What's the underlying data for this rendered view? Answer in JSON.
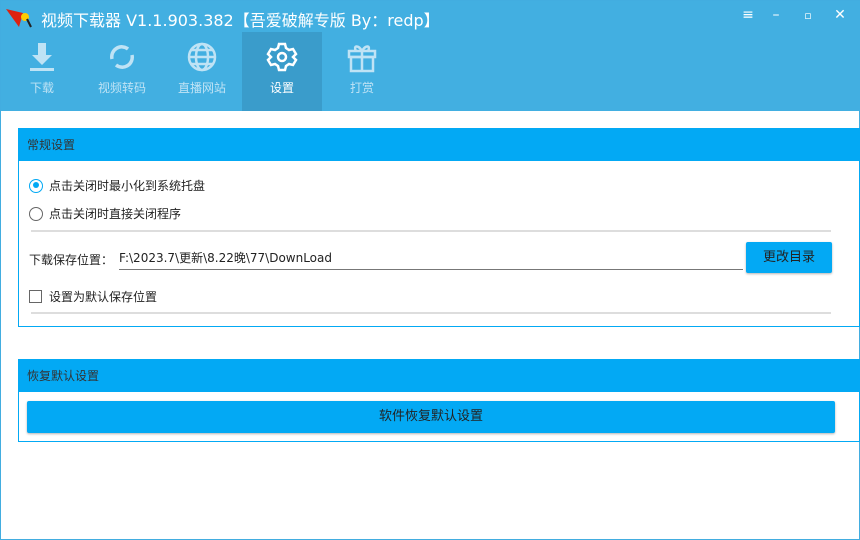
{
  "window": {
    "title": "视频下载器 V1.1.903.382【吾爱破解专版  By：redp】",
    "menu_icon": "menu-icon",
    "min_icon": "minimize-icon",
    "max_icon": "maximize-icon",
    "close_icon": "close-icon"
  },
  "tabs": [
    {
      "label": "下载",
      "icon": "download-icon"
    },
    {
      "label": "视频转码",
      "icon": "convert-icon"
    },
    {
      "label": "直播网站",
      "icon": "globe-icon"
    },
    {
      "label": "设置",
      "icon": "gear-icon",
      "active": true
    },
    {
      "label": "打赏",
      "icon": "gift-icon"
    }
  ],
  "general": {
    "title": "常规设置",
    "radio1": "点击关闭时最小化到系统托盘",
    "radio2": "点击关闭时直接关闭程序",
    "path_label": "下载保存位置：",
    "path_value": "F:\\2023.7\\更新\\8.22晚\\77\\DownLoad",
    "change_button": "更改目录",
    "default_checkbox": "设置为默认保存位置"
  },
  "restore": {
    "title": "恢复默认设置",
    "button": "软件恢复默认设置"
  },
  "colors": {
    "header": "#42afe1",
    "accent": "#03a9f4"
  }
}
